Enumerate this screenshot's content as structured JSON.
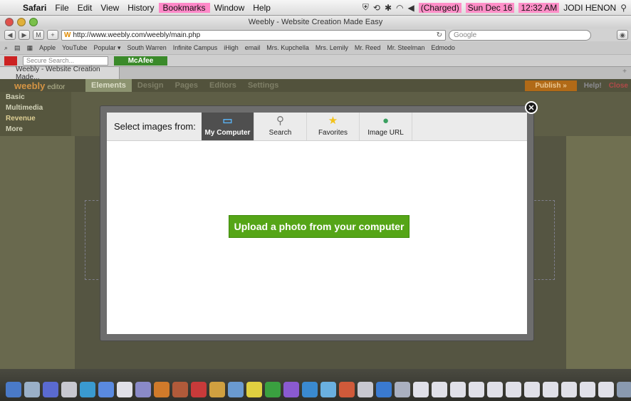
{
  "menubar": {
    "apple_icon": "apple-icon",
    "items": [
      "Safari",
      "File",
      "Edit",
      "View",
      "History",
      "Bookmarks",
      "Window",
      "Help"
    ],
    "battery": "(Charged)",
    "date": "Sun Dec 16",
    "time": "12:32 AM",
    "user": "JODI HENON"
  },
  "window": {
    "title": "Weebly - Website Creation Made Easy"
  },
  "toolbar": {
    "url": "http://www.weebly.com/weebly/main.php",
    "search_placeholder": "Google"
  },
  "bookmarks": [
    "Apple",
    "YouTube",
    "Popular ▾",
    "South Warren",
    "Infinite Campus",
    "iHigh",
    "email",
    "Mrs. Kupchella",
    "Mrs. Lemily",
    "Mr. Reed",
    "Mr. Steelman",
    "Edmodo"
  ],
  "mcafee": {
    "search_placeholder": "Secure Search...",
    "button": "McAfee"
  },
  "tabs": [
    {
      "label": "Weebly - Website Creation Made..."
    }
  ],
  "weebly": {
    "logo": "weebly",
    "logo_sub": "editor",
    "tabs": [
      "Elements",
      "Design",
      "Pages",
      "Editors",
      "Settings"
    ],
    "active_tab": "Elements",
    "publish": "Publish »",
    "help": "Help!",
    "close": "Close",
    "sidebar": [
      "Basic",
      "Multimedia",
      "Revenue",
      "More"
    ]
  },
  "modal": {
    "select_label": "Select images from:",
    "sources": [
      {
        "label": "My Computer",
        "icon": "monitor-icon",
        "active": true
      },
      {
        "label": "Search",
        "icon": "magnifier-icon",
        "active": false
      },
      {
        "label": "Favorites",
        "icon": "star-icon",
        "active": false
      },
      {
        "label": "Image URL",
        "icon": "globe-icon",
        "active": false
      }
    ],
    "upload_button": "Upload a photo from your computer",
    "close_icon": "close-circle-icon"
  },
  "colors": {
    "upload_green": "#55a517",
    "active_tab_bg": "#4f4f4f",
    "weebly_orange": "#e7a14a",
    "publish_bg": "#c0741a"
  }
}
